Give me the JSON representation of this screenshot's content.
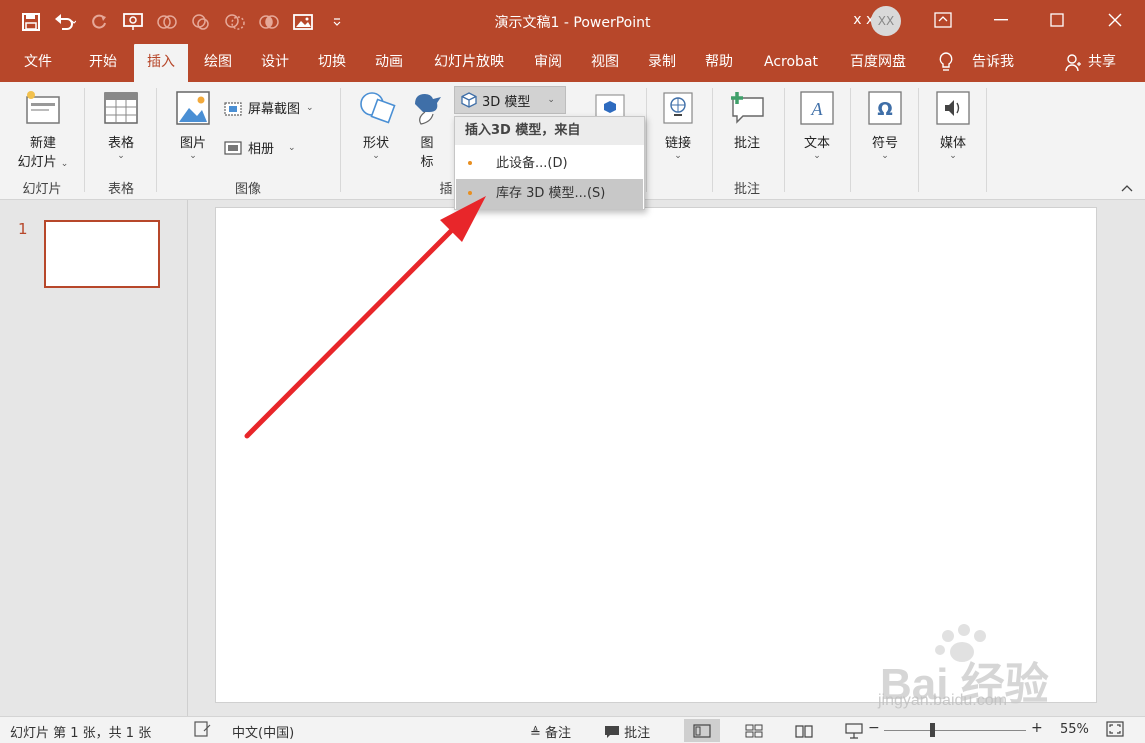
{
  "titlebar": {
    "doc_title": "演示文稿1  -  PowerPoint",
    "user_name": "x xjg",
    "avatar_initials": "XX",
    "accent": "#b7472a"
  },
  "tabs": [
    "文件",
    "开始",
    "插入",
    "绘图",
    "设计",
    "切换",
    "动画",
    "幻灯片放映",
    "审阅",
    "视图",
    "录制",
    "帮助",
    "Acrobat",
    "百度网盘",
    "告诉我",
    "共享"
  ],
  "active_tab": "插入",
  "ribbon": {
    "new_slide_line1": "新建",
    "new_slide_line2": "幻灯片",
    "group_slides": "幻灯片",
    "table": "表格",
    "group_table": "表格",
    "picture": "图片",
    "screenshot": "屏幕截图",
    "album": "相册",
    "group_images": "图像",
    "shapes": "形状",
    "icons_line1": "图",
    "icons_line2": "标",
    "group_illustrations_partial": "插",
    "model3d": "3D 模型",
    "links": "链接",
    "comment": "批注",
    "group_comments": "批注",
    "text": "文本",
    "symbol": "符号",
    "media": "媒体"
  },
  "dropdown": {
    "header": "插入3D 模型，来自",
    "item1": "此设备...(D)",
    "item2": "库存 3D 模型...(S)"
  },
  "slides": {
    "first_number": "1"
  },
  "status": {
    "slide_info": "幻灯片 第 1 张，共 1 张",
    "language": "中文(中国)",
    "notes": "备注",
    "comments": "批注",
    "zoom": "55%"
  },
  "watermark": {
    "brand": "Bai 经验",
    "url": "jingyan.baidu.com"
  }
}
